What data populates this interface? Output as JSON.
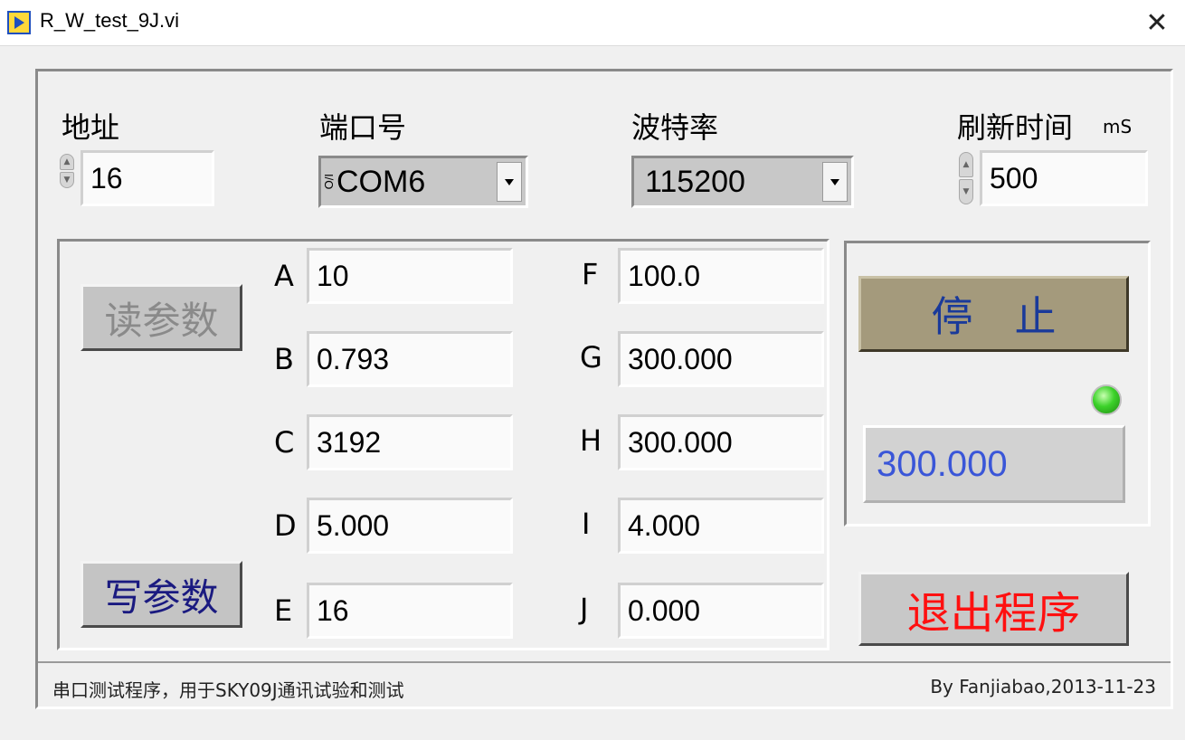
{
  "window": {
    "title": "R_W_test_9J.vi",
    "close_glyph": "✕"
  },
  "address": {
    "label": "地址",
    "value": "16"
  },
  "port": {
    "label": "端口号",
    "prefix": "I/O",
    "value": "COM6"
  },
  "baud": {
    "label": "波特率",
    "value": "115200"
  },
  "refresh": {
    "label": "刷新时间",
    "unit": "mS",
    "value": "500"
  },
  "buttons": {
    "read": "读参数",
    "write": "写参数",
    "stop": "停　止",
    "exit": "退出程序"
  },
  "params": [
    {
      "label": "A",
      "value": "10"
    },
    {
      "label": "B",
      "value": "0.793"
    },
    {
      "label": "C",
      "value": "3192"
    },
    {
      "label": "D",
      "value": "5.000"
    },
    {
      "label": "E",
      "value": "16"
    },
    {
      "label": "F",
      "value": "100.0"
    },
    {
      "label": "G",
      "value": "300.000"
    },
    {
      "label": "H",
      "value": "300.000"
    },
    {
      "label": "I",
      "value": "4.000"
    },
    {
      "label": "J",
      "value": "0.000"
    }
  ],
  "indicator": {
    "value": "300.000",
    "led_color": "#3cd22a"
  },
  "status": {
    "left": "串口测试程序，用于SKY09J通讯试验和测试",
    "right": "By Fanjiabao,2013-11-23"
  },
  "colors": {
    "write_text": "#1a1a80",
    "stop_text": "#1a3a9a",
    "exit_text": "#ff1010",
    "indicator_text": "#3a56d8",
    "read_text_disabled": "#8a8a8a"
  }
}
